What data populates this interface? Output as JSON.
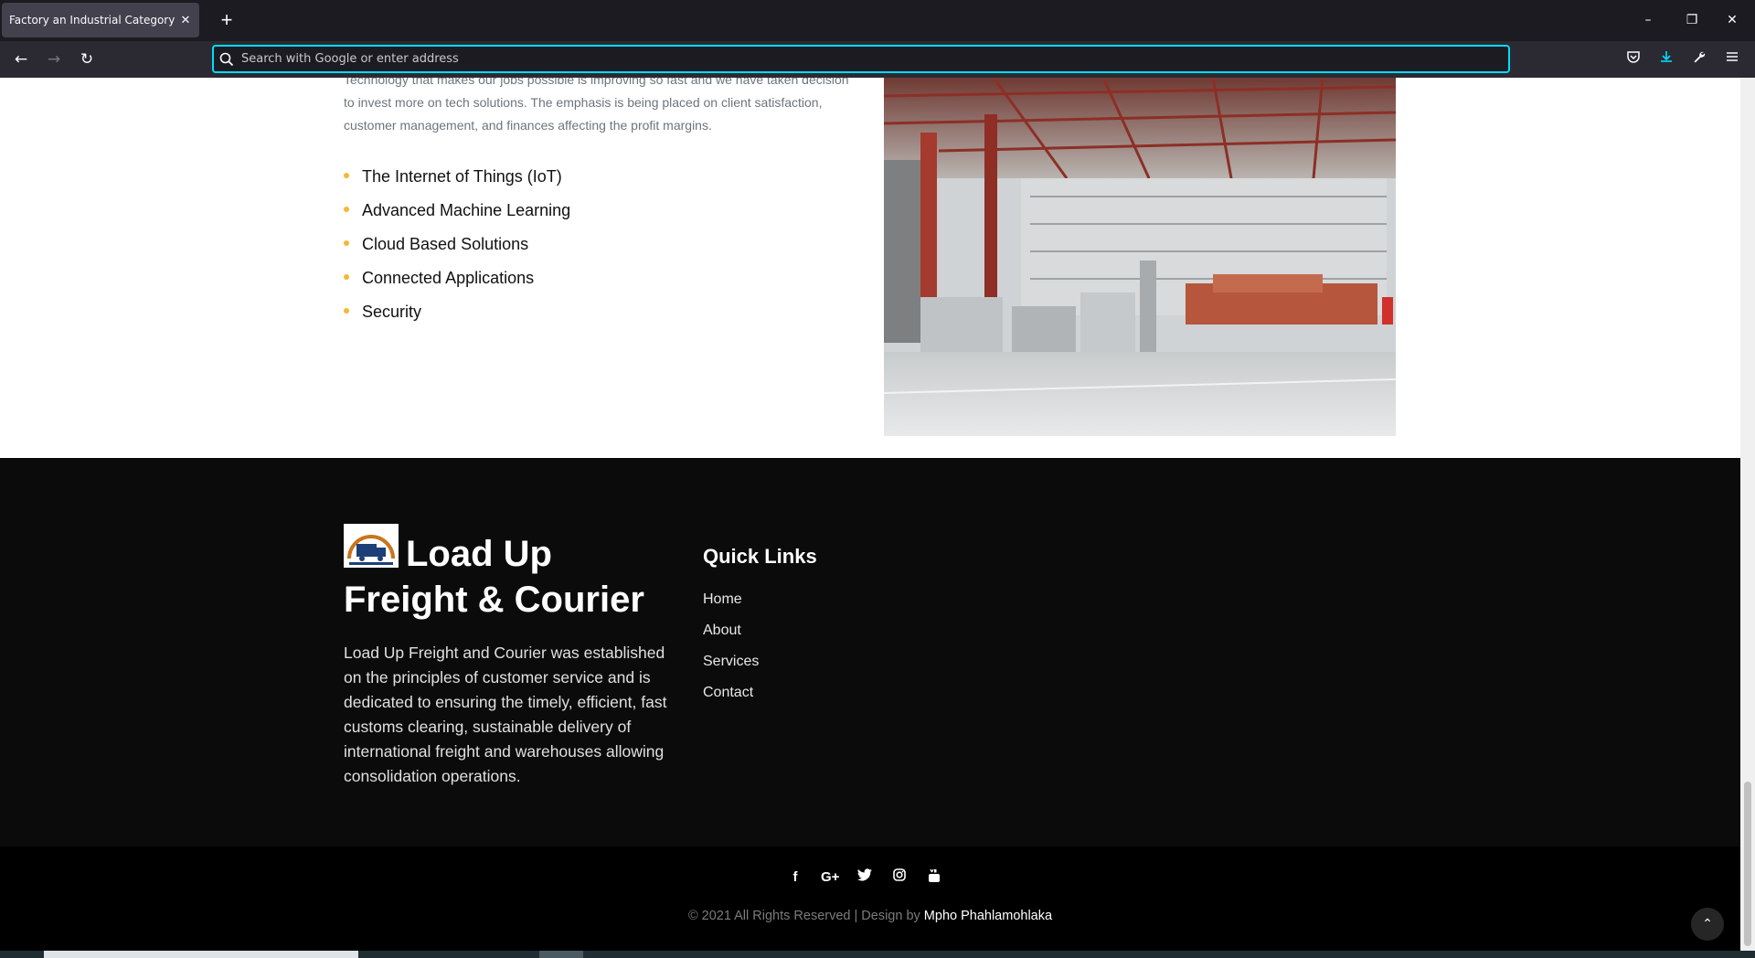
{
  "browser": {
    "tab_title": "Factory an Industrial Category Bootst",
    "tab_close": "✕",
    "new_tab": "+",
    "url_placeholder": "Search with Google or enter address",
    "window_minimize": "–",
    "window_restore": "❐",
    "window_close": "✕"
  },
  "about": {
    "paragraph": "Technology that makes our jobs possible is improving so fast and we have taken decision to invest more on tech solutions. The emphasis is being placed on client satisfaction, customer management, and finances affecting the profit margins.",
    "features": [
      "The Internet of Things (IoT)",
      "Advanced Machine Learning",
      "Cloud Based Solutions",
      "Connected Applications",
      "Security"
    ],
    "bullet_color": "#f7b733"
  },
  "footer": {
    "brand_line1": "Load Up",
    "brand_line2": "Freight & Courier",
    "description": "Load Up Freight and Courier was established on the principles of customer service and is dedicated to ensuring the timely, efficient, fast customs clearing, sustainable delivery of international freight and warehouses allowing consolidation operations.",
    "quick_links_title": "Quick Links",
    "quick_links": [
      "Home",
      "About",
      "Services",
      "Contact"
    ],
    "socials": [
      "facebook-icon",
      "google-plus-icon",
      "twitter-icon",
      "instagram-icon",
      "youtube-icon"
    ],
    "copyright": "© 2021 All Rights Reserved | Design by",
    "author": "Mpho Phahlamohlaka",
    "to_top": "⌃"
  }
}
